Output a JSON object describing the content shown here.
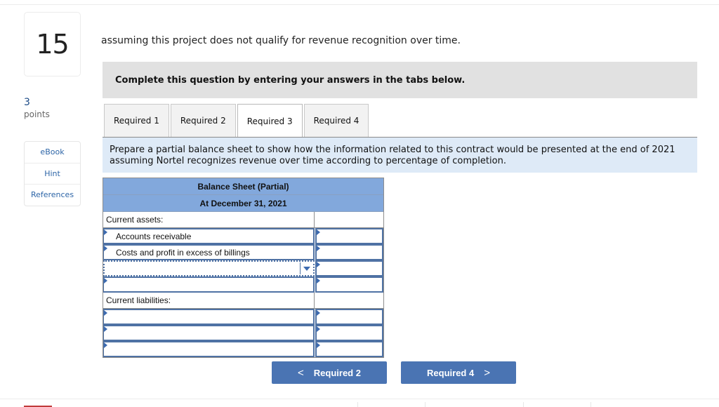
{
  "question": {
    "number": "15",
    "points_value": "3",
    "points_label": "points",
    "intro_text": "assuming this project does not qualify for revenue recognition over time."
  },
  "sidebar": {
    "items": [
      {
        "label": "eBook"
      },
      {
        "label": "Hint"
      },
      {
        "label": "References"
      }
    ]
  },
  "banner": {
    "text": "Complete this question by entering your answers in the tabs below."
  },
  "tabs": [
    {
      "label": "Required 1",
      "active": false
    },
    {
      "label": "Required 2",
      "active": false
    },
    {
      "label": "Required 3",
      "active": true
    },
    {
      "label": "Required 4",
      "active": false
    }
  ],
  "instructions": {
    "line1": "Prepare a partial balance sheet to show how the information related to this contract would be presented at the end of 2021",
    "line2": "assuming Nortel recognizes revenue over time according to percentage of completion."
  },
  "balance_sheet": {
    "title": "Balance Sheet (Partial)",
    "date": "At December 31, 2021",
    "rows": [
      {
        "label": "Current assets:",
        "type": "heading",
        "value": ""
      },
      {
        "label": "Accounts receivable",
        "type": "input",
        "value": ""
      },
      {
        "label": "Costs and profit in excess of billings",
        "type": "input",
        "value": ""
      },
      {
        "label": "",
        "type": "dropdown",
        "value": ""
      },
      {
        "label": "",
        "type": "input",
        "value": ""
      },
      {
        "label": "Current liabilities:",
        "type": "heading",
        "value": ""
      },
      {
        "label": "",
        "type": "input",
        "value": ""
      },
      {
        "label": "",
        "type": "input",
        "value": ""
      },
      {
        "label": "",
        "type": "input",
        "value": ""
      }
    ]
  },
  "navigation": {
    "prev_label": "Required 2",
    "prev_icon": "chevron-left-icon",
    "next_label": "Required 4",
    "next_icon": "chevron-right-icon",
    "prev_glyph": "<",
    "next_glyph": ">"
  },
  "colors": {
    "accent": "#4a74b3",
    "table_header": "#82a8dc",
    "instruction_bg": "#deeaf7",
    "banner_bg": "#e1e1e1"
  }
}
